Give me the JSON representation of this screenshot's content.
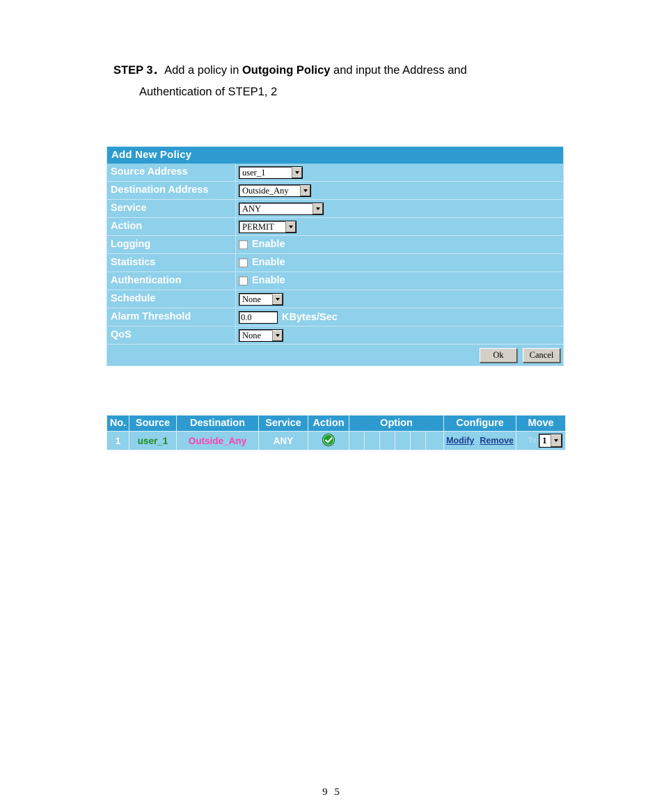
{
  "step": {
    "label": "STEP 3",
    "separator": "．",
    "text_before_bold": "Add a policy in ",
    "bold_term": "Outgoing Policy",
    "text_after_bold": " and input the Address and",
    "line2": "Authentication of STEP1, 2"
  },
  "panel": {
    "title": "Add New Policy",
    "rows": [
      {
        "label": "Source Address",
        "control": "select",
        "value": "user_1"
      },
      {
        "label": "Destination Address",
        "control": "select",
        "value": "Outside_Any"
      },
      {
        "label": "Service",
        "control": "select",
        "value": "ANY"
      },
      {
        "label": "Action",
        "control": "select",
        "value": "PERMIT"
      },
      {
        "label": "Logging",
        "control": "checkbox",
        "value": "Enable",
        "checked": false
      },
      {
        "label": "Statistics",
        "control": "checkbox",
        "value": "Enable",
        "checked": false
      },
      {
        "label": "Authentication",
        "control": "checkbox",
        "value": "Enable",
        "checked": false
      },
      {
        "label": "Schedule",
        "control": "select",
        "value": "None"
      },
      {
        "label": "Alarm Threshold",
        "control": "text",
        "value": "0.0",
        "unit": "KBytes/Sec"
      },
      {
        "label": "QoS",
        "control": "select",
        "value": "None"
      }
    ],
    "buttons": {
      "ok": "Ok",
      "cancel": "Cancel"
    }
  },
  "policy_table": {
    "headers": {
      "no": "No.",
      "source": "Source",
      "destination": "Destination",
      "service": "Service",
      "action": "Action",
      "option": "Option",
      "configure": "Configure",
      "move": "Move"
    },
    "option_subcells": 6,
    "rows": [
      {
        "no": "1",
        "source": "user_1",
        "destination": "Outside_Any",
        "service": "ANY",
        "action_icon": "green-check-icon",
        "modify": "Modify",
        "remove": "Remove",
        "to_label": "To",
        "move_value": "1"
      }
    ]
  },
  "footer": {
    "page_number": "9 5"
  },
  "colors": {
    "header_blue": "#2e9bd0",
    "panel_blue": "#8fd0ea",
    "grid_line": "#d8eefa",
    "source_green": "#1f8a1f",
    "destination_pink": "#ff3fae",
    "link_blue": "#1b3f8f",
    "check_green": "#1e9e2e"
  }
}
